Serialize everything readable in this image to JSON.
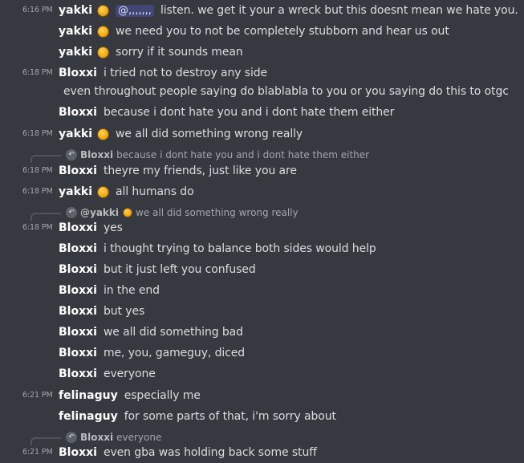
{
  "messages": [
    {
      "time": "6:16 PM",
      "user": "yakki",
      "emoji": true,
      "mention": "@,,,,,,,",
      "text": "listen. we get it your a wreck but this doesnt mean we hate you."
    },
    {
      "user": "yakki",
      "emoji": true,
      "text": "we need you to not be completely stubborn and hear us out"
    },
    {
      "user": "yakki",
      "emoji": true,
      "text": "sorry if it sounds mean"
    },
    {
      "time": "6:18 PM",
      "user": "Bloxxi",
      "text": "i tried not to destroy any side"
    },
    {
      "continuation": "even throughout people saying do blablabla to you or you saying do this to otgc"
    },
    {
      "user": "Bloxxi",
      "text": "because i dont hate you and i dont hate them either"
    },
    {
      "time": "6:18 PM",
      "user": "yakki",
      "emoji": true,
      "text": "we all did something wrong really"
    },
    {
      "reply": {
        "user": "Bloxxi",
        "text": "because i dont hate you and i dont hate them either"
      }
    },
    {
      "time": "6:18 PM",
      "user": "Bloxxi",
      "text": "theyre my friends, just like you are"
    },
    {
      "time": "6:18 PM",
      "user": "yakki",
      "emoji": true,
      "text": "all humans do"
    },
    {
      "reply": {
        "user": "@yakki",
        "emoji": true,
        "text": "we all did something wrong really"
      }
    },
    {
      "time": "6:18 PM",
      "user": "Bloxxi",
      "text": "yes"
    },
    {
      "user": "Bloxxi",
      "text": "i thought trying to balance both sides would help"
    },
    {
      "user": "Bloxxi",
      "text": "but it just left you confused"
    },
    {
      "user": "Bloxxi",
      "text": "in the end"
    },
    {
      "user": "Bloxxi",
      "text": "but yes"
    },
    {
      "user": "Bloxxi",
      "text": "we all did something bad"
    },
    {
      "user": "Bloxxi",
      "text": "me, you, gameguy, diced"
    },
    {
      "user": "Bloxxi",
      "text": "everyone"
    },
    {
      "time": "6:21 PM",
      "user": "felinaguy",
      "text": "especially me"
    },
    {
      "user": "felinaguy",
      "text": "for some parts of that, i'm sorry about"
    },
    {
      "reply": {
        "user": "Bloxxi",
        "text": "everyone"
      }
    },
    {
      "time": "6:21 PM",
      "user": "Bloxxi",
      "text": "even gba was holding back some stuff"
    }
  ],
  "icons": {
    "reply": "reply-arrow-icon",
    "emoji": "cookie-emoji-icon"
  },
  "colors": {
    "background": "#36393f",
    "mention_bg": "#414675",
    "text": "#dcddde",
    "username": "#ffffff"
  }
}
